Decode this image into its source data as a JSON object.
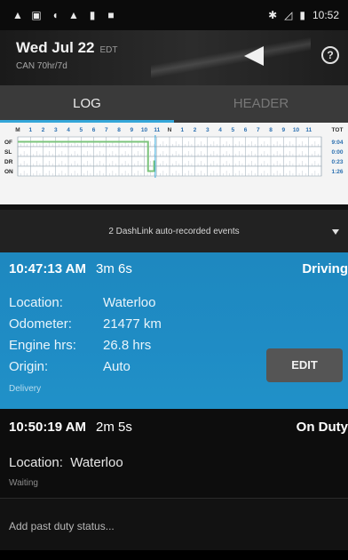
{
  "status_bar": {
    "left_icons": [
      "warning-icon",
      "gallery-icon",
      "volume-icon",
      "warning-icon",
      "person-icon",
      "square-icon"
    ],
    "right_icons": [
      "bluetooth-icon",
      "signal-icon",
      "battery-icon"
    ],
    "time": "10:52"
  },
  "header": {
    "date": "Wed Jul 22",
    "timezone": "EDT",
    "cycle": "CAN 70hr/7d",
    "help": "?"
  },
  "tabs": [
    {
      "label": "LOG",
      "active": true
    },
    {
      "label": "HEADER",
      "active": false
    }
  ],
  "grid": {
    "hour_labels": [
      "M",
      "1",
      "2",
      "3",
      "4",
      "5",
      "6",
      "7",
      "8",
      "9",
      "10",
      "11",
      "N",
      "1",
      "2",
      "3",
      "4",
      "5",
      "6",
      "7",
      "8",
      "9",
      "10",
      "11"
    ],
    "tot_label": "TOT",
    "rows": [
      {
        "label": "OF",
        "total": "9:04"
      },
      {
        "label": "SL",
        "total": "0:00"
      },
      {
        "label": "DR",
        "total": "0:23"
      },
      {
        "label": "ON",
        "total": "1:26"
      }
    ],
    "line_color": "#7cc47c"
  },
  "events_bar": {
    "text": "2 DashLink auto-recorded events"
  },
  "driving_card": {
    "time": "10:47:13 AM",
    "duration": "3m 6s",
    "status": "Driving",
    "location_label": "Location:",
    "location": "Waterloo",
    "odometer_label": "Odometer:",
    "odometer": "21477 km",
    "engine_label": "Engine hrs:",
    "engine": "26.8 hrs",
    "origin_label": "Origin:",
    "origin": "Auto",
    "note": "Delivery",
    "edit": "EDIT",
    "color": "#1f8cc5"
  },
  "onduty_card": {
    "time": "10:50:19 AM",
    "duration": "2m 5s",
    "status": "On Duty",
    "location_label": "Location:",
    "location": "Waterloo",
    "note": "Waiting"
  },
  "add_past": "Add past duty status..."
}
